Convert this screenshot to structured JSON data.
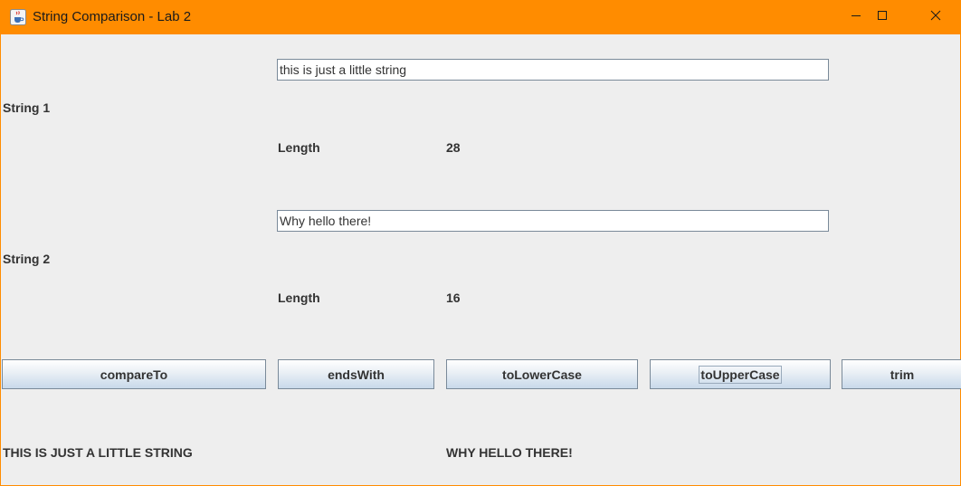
{
  "window": {
    "title": "String Comparison - Lab 2",
    "title_bar_color": "#ff8c00"
  },
  "string1": {
    "label": "String 1",
    "value": "this is just a little string",
    "length_label": "Length",
    "length_value": "28"
  },
  "string2": {
    "label": "String 2",
    "value": "Why hello there!",
    "length_label": "Length",
    "length_value": "16"
  },
  "buttons": {
    "compare": "compareTo",
    "ends_with": "endsWith",
    "to_lower": "toLowerCase",
    "to_upper": "toUpperCase",
    "trim": "trim"
  },
  "results": {
    "result1": "THIS IS JUST A LITTLE STRING",
    "result2": "WHY HELLO THERE!"
  },
  "icons": {
    "app": "java-cup-icon",
    "minimize": "minimize-icon",
    "maximize": "maximize-icon",
    "close": "close-icon"
  }
}
